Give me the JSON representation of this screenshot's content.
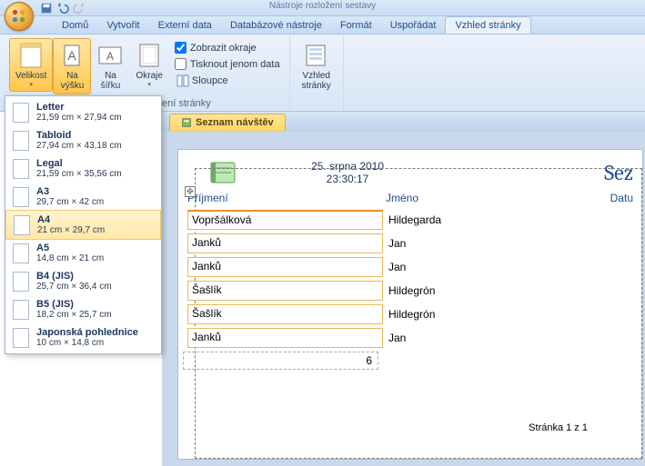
{
  "title_bar": "Nástroje rozložení sestavy",
  "tabs": {
    "items": [
      "Domů",
      "Vytvořit",
      "Externí data",
      "Databázové nástroje",
      "Formát",
      "Uspořádat",
      "Vzhled stránky"
    ],
    "active": 6
  },
  "ribbon": {
    "velikost": "Velikost",
    "na_vysku": "Na\nvýšku",
    "na_sirku": "Na\nšířku",
    "okraje": "Okraje",
    "zobrazit_okraje": "Zobrazit okraje",
    "tisknout_jenom": "Tisknout jenom data",
    "sloupce": "Sloupce",
    "vzhled_stranky": "Vzhled\nstránky",
    "group_label_partial": "ení stránky"
  },
  "paper_sizes": [
    {
      "name": "Letter",
      "dim": "21,59 cm × 27,94 cm"
    },
    {
      "name": "Tabloid",
      "dim": "27,94 cm × 43,18 cm"
    },
    {
      "name": "Legal",
      "dim": "21,59 cm × 35,56 cm"
    },
    {
      "name": "A3",
      "dim": "29,7 cm × 42 cm"
    },
    {
      "name": "A4",
      "dim": "21 cm × 29,7 cm"
    },
    {
      "name": "A5",
      "dim": "14,8 cm × 21 cm"
    },
    {
      "name": "B4 (JIS)",
      "dim": "25,7 cm × 36,4 cm"
    },
    {
      "name": "B5 (JIS)",
      "dim": "18,2 cm × 25,7 cm"
    },
    {
      "name": "Japonská pohlednice",
      "dim": "10 cm × 14,8 cm"
    }
  ],
  "paper_selected": 4,
  "doc_tab": "Seznam návštěv",
  "report": {
    "date": "25. srpna 2010",
    "time": "23:30:17",
    "title_cut": "Sez",
    "col1": "Příjmení",
    "col2": "Jméno",
    "col3_cut": "Datu",
    "rows": [
      {
        "prijmeni": "Vopršálková",
        "jmeno": "Hildegarda"
      },
      {
        "prijmeni": "Janků",
        "jmeno": "Jan"
      },
      {
        "prijmeni": "Janků",
        "jmeno": "Jan"
      },
      {
        "prijmeni": "Šašlík",
        "jmeno": "Hildegrón"
      },
      {
        "prijmeni": "Šašlík",
        "jmeno": "Hildegrón"
      },
      {
        "prijmeni": "Janků",
        "jmeno": "Jan"
      }
    ],
    "count": "6",
    "pager": "Stránka 1 z 1"
  }
}
